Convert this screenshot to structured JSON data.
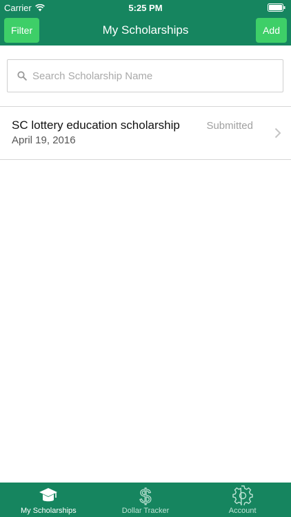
{
  "status_bar": {
    "carrier": "Carrier",
    "time": "5:25 PM",
    "icons": [
      "wifi-icon",
      "battery-icon"
    ]
  },
  "nav": {
    "title": "My Scholarships",
    "filter_label": "Filter",
    "add_label": "Add"
  },
  "search": {
    "placeholder": "Search Scholarship Name",
    "value": "",
    "icon": "search-icon"
  },
  "scholarships": [
    {
      "name": "SC lottery education scholarship",
      "date": "April 19, 2016",
      "status": "Submitted"
    }
  ],
  "tabs": [
    {
      "label": "My Scholarships",
      "icon": "graduation-cap-icon",
      "active": true
    },
    {
      "label": "Dollar Tracker",
      "icon": "dollar-icon",
      "active": false
    },
    {
      "label": "Account",
      "icon": "gear-icon",
      "active": false
    }
  ],
  "colors": {
    "primary": "#16855f",
    "accent_button": "#3ecf68"
  }
}
